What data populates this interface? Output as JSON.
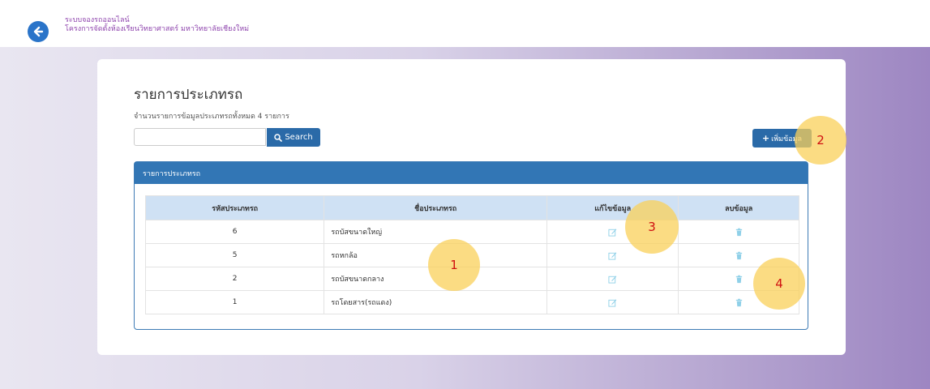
{
  "header": {
    "system_name": "ระบบจองรถออนไลน์",
    "project_name": "โครงการจัดตั้งห้องเรียนวิทยาศาสตร์ มหาวิทยาลัยเชียงใหม่"
  },
  "page": {
    "title": "รายการประเภทรถ",
    "count_text": "จำนวนรายการข้อมูลประเภทรถทั้งหมด 4 รายการ"
  },
  "search": {
    "value": "",
    "placeholder": "",
    "button_label": "Search"
  },
  "add_button": {
    "label": "เพิ่มข้อมูล"
  },
  "panel": {
    "title": "รายการประเภทรถ"
  },
  "table": {
    "headers": [
      "รหัสประเภทรถ",
      "ชื่อประเภทรถ",
      "แก้ไขข้อมูล",
      "ลบข้อมูล"
    ],
    "rows": [
      {
        "id": "6",
        "name": "รถบัสขนาดใหญ่"
      },
      {
        "id": "5",
        "name": "รถหกล้อ"
      },
      {
        "id": "2",
        "name": "รถบัสขนาดกลาง"
      },
      {
        "id": "1",
        "name": "รถโดยสาร(รถแดง)"
      }
    ]
  },
  "markers": [
    "1",
    "2",
    "3",
    "4"
  ],
  "colors": {
    "primary": "#2a6aa8",
    "panel_header": "#3276b5",
    "table_header": "#cfe1f4",
    "marker": "#fad05a",
    "marker_text": "#d01010",
    "header_text": "#8e44ad",
    "icon": "#8fd0e8"
  },
  "icons": [
    "back-arrow-icon",
    "search-icon",
    "plus-icon",
    "edit-icon",
    "trash-icon"
  ]
}
